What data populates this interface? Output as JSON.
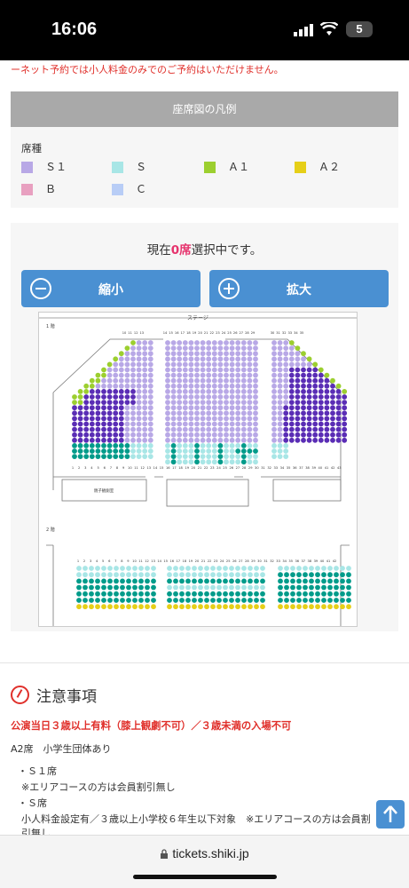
{
  "status": {
    "time": "16:06",
    "battery": "5"
  },
  "top_notice": "ーネット予約では小人料金のみでのご予約はいただけません。",
  "legend": {
    "title": "座席図の凡例",
    "type_label": "席種",
    "items": [
      {
        "label": "Ｓ１",
        "color": "#b8a8e6"
      },
      {
        "label": "Ｓ",
        "color": "#a8e6e6"
      },
      {
        "label": "Ａ１",
        "color": "#9ccf2f"
      },
      {
        "label": "Ａ２",
        "color": "#e6cf18"
      },
      {
        "label": "Ｂ",
        "color": "#e8a0c0"
      },
      {
        "label": "Ｃ",
        "color": "#b8cdf6"
      }
    ]
  },
  "selection": {
    "prefix": "現在",
    "count": "0席",
    "suffix": "選択中です。"
  },
  "zoom": {
    "out_label": "縮小",
    "in_label": "拡大"
  },
  "seat_map": {
    "stage_label": "ステージ",
    "floor1_label": "1 階",
    "floor2_label": "2 階",
    "room_label": "親子観劇室",
    "colors": {
      "s1": "#b8a8e6",
      "s": "#a8e6e6",
      "a1": "#9ccf2f",
      "a2": "#e6cf18",
      "sold_dark": "#5a2db5",
      "sold_teal": "#009b8a"
    },
    "f1_top_numbers": [
      "10",
      "11",
      "12",
      "13",
      "14",
      "15",
      "16",
      "17",
      "18",
      "19",
      "20",
      "21",
      "22",
      "23",
      "24",
      "25",
      "26",
      "27",
      "28",
      "29",
      "30",
      "31",
      "32",
      "33",
      "34",
      "35"
    ],
    "f1_bottom_numbers": [
      "1",
      "2",
      "3",
      "4",
      "5",
      "6",
      "7",
      "8",
      "9",
      "10",
      "11",
      "12",
      "13",
      "14",
      "15",
      "16",
      "17",
      "18",
      "19",
      "20",
      "21",
      "22",
      "23",
      "24",
      "25",
      "26",
      "27",
      "28",
      "29",
      "30",
      "31",
      "32",
      "33",
      "34",
      "35",
      "36",
      "37",
      "38",
      "39",
      "40",
      "41",
      "42",
      "43"
    ],
    "f2_top_numbers": [
      "1",
      "2",
      "3",
      "4",
      "5",
      "6",
      "7",
      "8",
      "9",
      "10",
      "11",
      "12",
      "13",
      "14",
      "15",
      "16",
      "17",
      "18",
      "19",
      "20",
      "21",
      "22",
      "23",
      "24",
      "25",
      "26",
      "27",
      "28",
      "29",
      "30",
      "31",
      "32",
      "33",
      "34",
      "35",
      "36",
      "37",
      "38",
      "39",
      "40",
      "41",
      "42"
    ]
  },
  "notes": {
    "title": "注意事項",
    "red_line": "公演当日３歳以上有料（膝上観劇不可）／３歳未満の入場不可",
    "a2": "A2席　小学生団体あり",
    "s1_title": "・Ｓ１席",
    "s1_body": "※エリアコースの方は会員割引無し",
    "s_title": "・Ｓ席",
    "s_body": "小人料金設定有／３歳以上小学校６年生以下対象　※エリアコースの方は会員割",
    "s_body2": "引無し"
  },
  "browser": {
    "url": "tickets.shiki.jp"
  }
}
